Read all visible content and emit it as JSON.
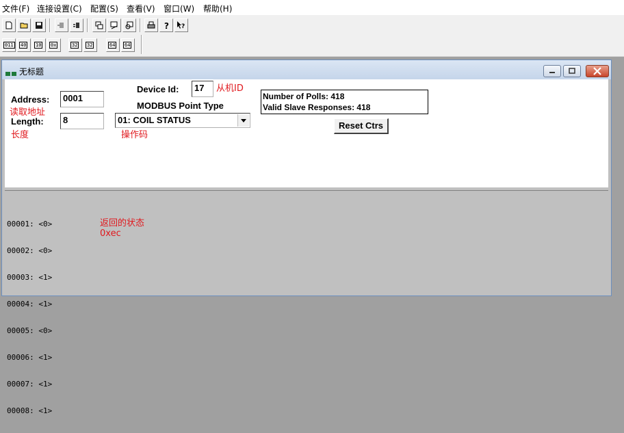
{
  "menu": [
    "文件(F)",
    "连接设置(C)",
    "配置(S)",
    "查看(V)",
    "窗口(W)",
    "帮助(H)"
  ],
  "toolbar_row1": [
    "new-document-icon",
    "open-folder-icon",
    "save-disk-icon",
    "connect-icon",
    "disconnect-icon",
    "poll-definition-icon",
    "display-icon",
    "slave-icon",
    "print-icon",
    "help-icon",
    "context-help-icon"
  ],
  "toolbar_row2": [
    "011",
    "40",
    "10",
    "0x",
    "32",
    "32",
    "64",
    "64"
  ],
  "window": {
    "title": "无标题"
  },
  "form": {
    "address_label": "Address:",
    "address_value": "0001",
    "address_note": "读取地址",
    "length_label": "Length:",
    "length_value": "8",
    "length_note": "长度",
    "device_id_label": "Device Id:",
    "device_id_value": "17",
    "device_id_note": "从机ID",
    "point_type_label": "MODBUS Point Type",
    "point_type_value": "01: COIL STATUS",
    "point_type_note": "操作码",
    "polls_text": "Number of Polls: 418",
    "responses_text": "Valid Slave Responses: 418",
    "reset_label": "Reset Ctrs"
  },
  "log": {
    "lines": [
      "00001: <0>",
      "00002: <0>",
      "00003: <1>",
      "00004: <1>",
      "00005: <0>",
      "00006: <1>",
      "00007: <1>",
      "00008: <1>"
    ],
    "note1": "返回的状态",
    "note2": "0xec"
  }
}
